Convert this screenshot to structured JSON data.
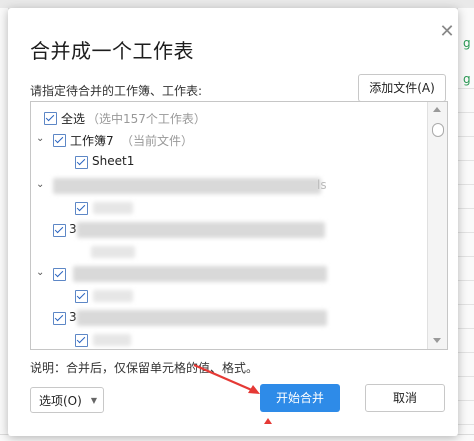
{
  "dialog": {
    "title": "合并成一个工作表",
    "prompt": "请指定待合并的工作簿、工作表:",
    "add_file_label": "添加文件(A)",
    "note": "说明：合并后，仅保留单元格的值、格式。",
    "options_label": "选项(O)",
    "start_label": "开始合并",
    "cancel_label": "取消"
  },
  "tree": {
    "select_all_label": "全选",
    "select_all_note": "（选中157个工作表）",
    "workbook_label": "工作簿7",
    "workbook_note": "（当前文件）",
    "sheet_label": "Sheet1",
    "blurred_suffix": "ls",
    "blurred_digit": "3"
  },
  "colors": {
    "accent": "#2e8be8",
    "annotation": "#e53935"
  },
  "icons": {
    "close": "close-icon",
    "caret": "caret-down-icon",
    "chevron": "chevron-down-icon",
    "checkbox": "checkbox-checked-icon"
  }
}
